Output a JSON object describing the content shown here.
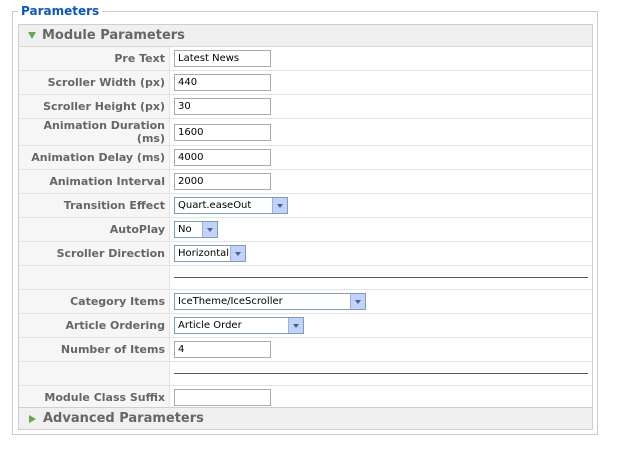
{
  "fieldset": {
    "legend": "Parameters"
  },
  "module_panel": {
    "title": "Module Parameters",
    "rows": [
      {
        "label": "Pre Text",
        "type": "text",
        "value": "Latest News"
      },
      {
        "label": "Scroller Width (px)",
        "type": "text",
        "value": "440"
      },
      {
        "label": "Scroller Height (px)",
        "type": "text",
        "value": "30"
      },
      {
        "label": "Animation Duration (ms)",
        "type": "text",
        "value": "1600"
      },
      {
        "label": "Animation Delay (ms)",
        "type": "text",
        "value": "4000"
      },
      {
        "label": "Animation Interval",
        "type": "text",
        "value": "2000"
      },
      {
        "label": "Transition Effect",
        "type": "select",
        "value": "Quart.easeOut"
      },
      {
        "label": "AutoPlay",
        "type": "select",
        "value": "No"
      },
      {
        "label": "Scroller Direction",
        "type": "select",
        "value": "Horizontal"
      },
      {
        "label": "",
        "type": "separator"
      },
      {
        "label": "Category Items",
        "type": "select",
        "value": "IceTheme/IceScroller"
      },
      {
        "label": "Article Ordering",
        "type": "select",
        "value": "Article Order"
      },
      {
        "label": "Number of Items",
        "type": "text",
        "value": "4"
      },
      {
        "label": "",
        "type": "separator"
      },
      {
        "label": "Module Class Suffix",
        "type": "text",
        "value": ""
      }
    ]
  },
  "advanced_panel": {
    "title": "Advanced Parameters"
  },
  "icons": {
    "expanded": "triangle-down-icon",
    "collapsed": "triangle-right-icon",
    "select_arrow": "chevron-down-icon",
    "accent": "#6aa84f",
    "legend_color": "#0b55c4"
  }
}
